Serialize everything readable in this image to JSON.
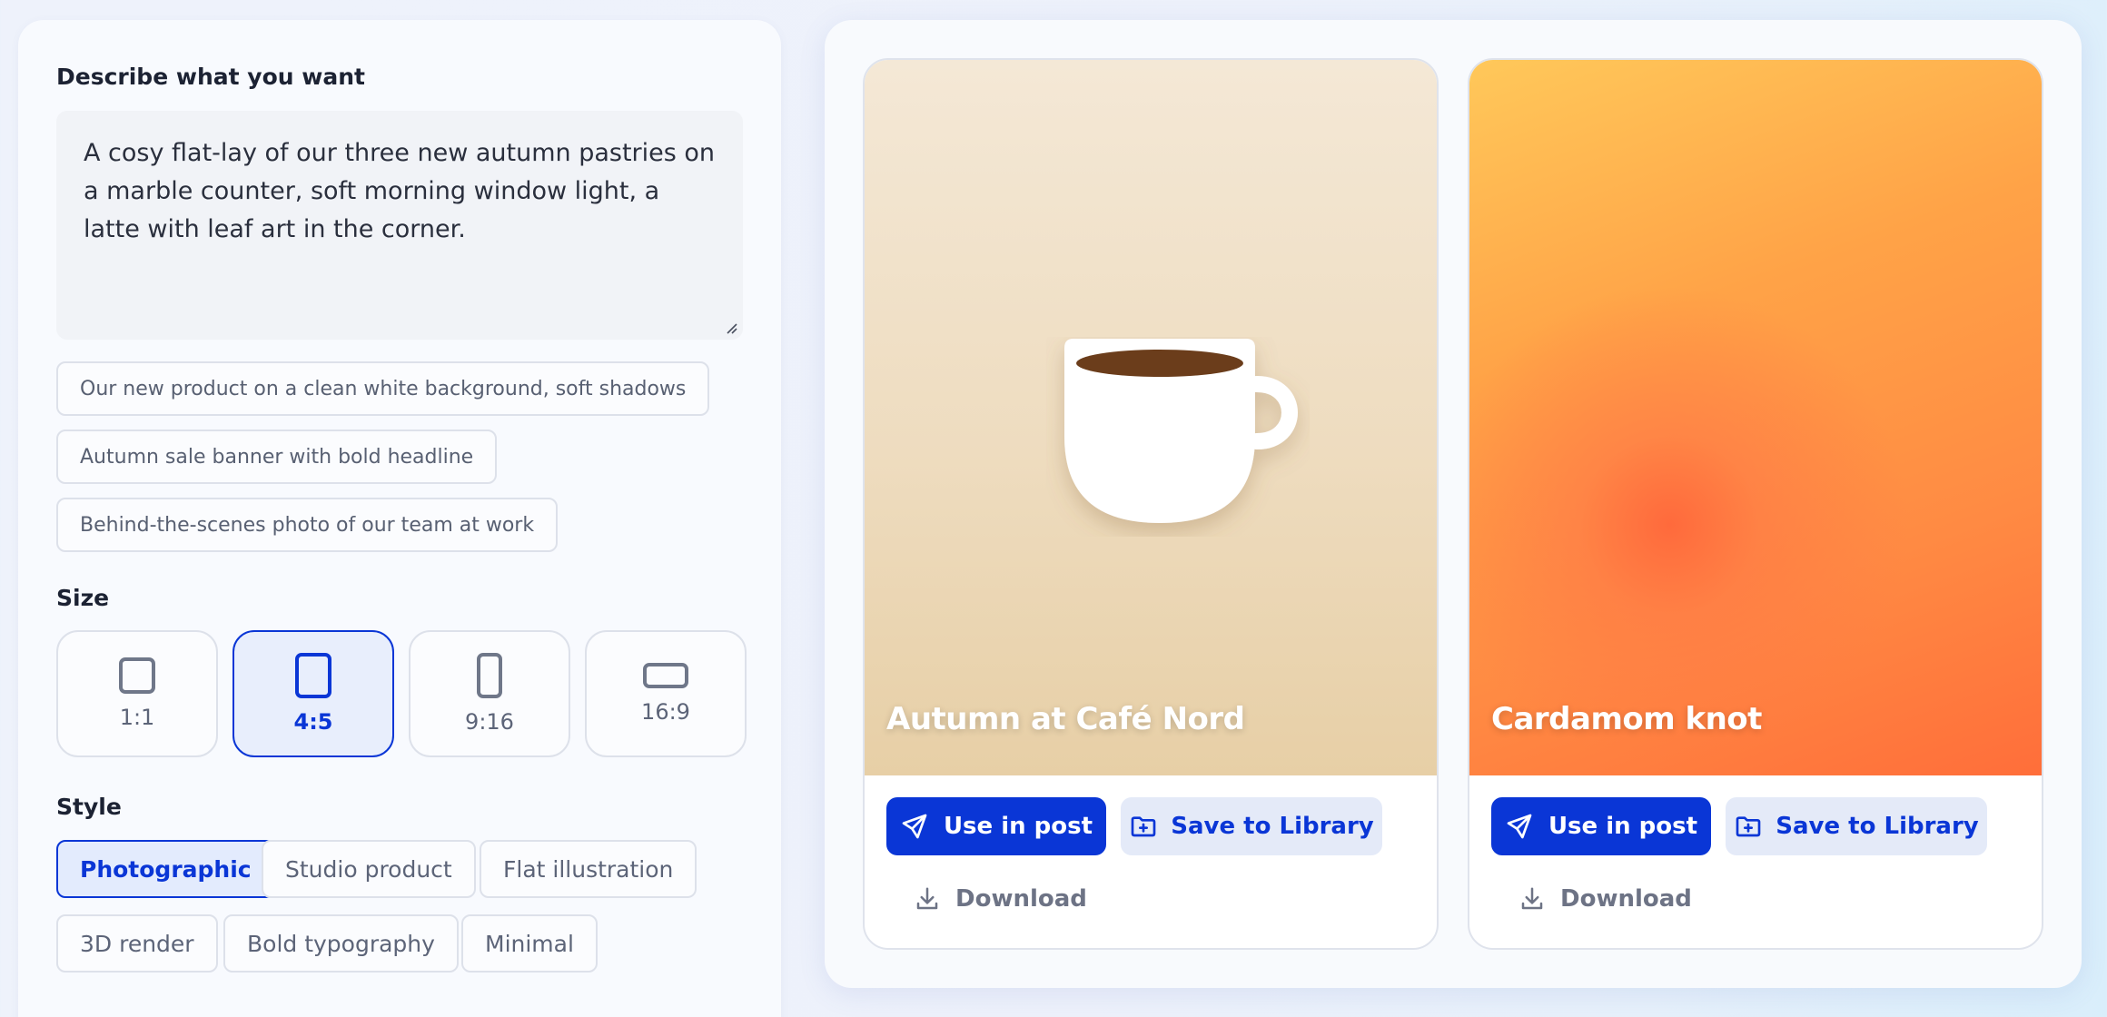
{
  "generator": {
    "prompt_label": "Describe what you want",
    "prompt_value": "A cosy flat-lay of our three new autumn pastries on a marble counter, soft morning window light, a latte with leaf art in the corner.",
    "suggestions": [
      "Our new product on a clean white background, soft shadows",
      "Autumn sale banner with bold headline",
      "Behind-the-scenes photo of our team at work"
    ],
    "size_label": "Size",
    "sizes": [
      {
        "label": "1:1",
        "selected": false
      },
      {
        "label": "4:5",
        "selected": true
      },
      {
        "label": "9:16",
        "selected": false
      },
      {
        "label": "16:9",
        "selected": false
      }
    ],
    "style_label": "Style",
    "styles": [
      {
        "label": "Photographic",
        "selected": true
      },
      {
        "label": "Studio product",
        "selected": false
      },
      {
        "label": "Flat illustration",
        "selected": false
      },
      {
        "label": "3D render",
        "selected": false
      },
      {
        "label": "Bold typography",
        "selected": false
      },
      {
        "label": "Minimal",
        "selected": false
      }
    ]
  },
  "results": [
    {
      "caption": "Autumn at Café Nord",
      "use_label": "Use in post",
      "save_label": "Save to Library",
      "download_label": "Download",
      "image_icon": "coffee-cup"
    },
    {
      "caption": "Cardamom knot",
      "use_label": "Use in post",
      "save_label": "Save to Library",
      "download_label": "Download",
      "image_icon": "none"
    }
  ],
  "colors": {
    "accent": "#0a36d6",
    "accent_soft": "#e4eaf8",
    "panel_bg": "#f8fafe",
    "coffee": "#6b3d1b"
  }
}
